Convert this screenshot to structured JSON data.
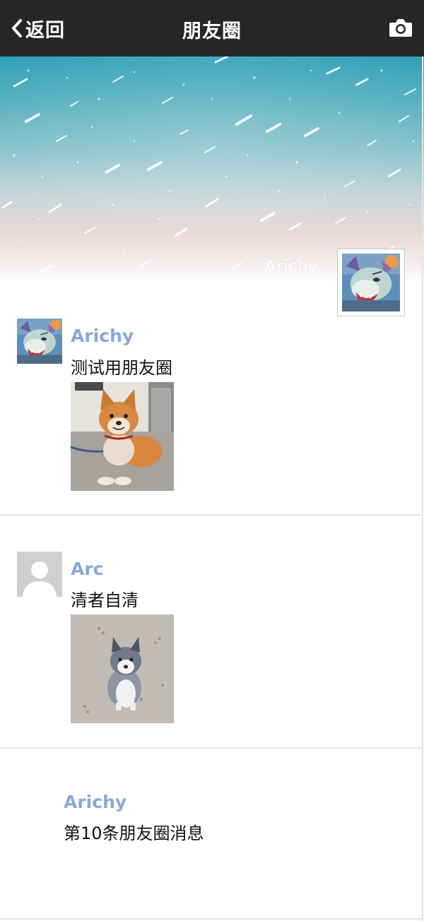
{
  "header": {
    "back_label": "返回",
    "title": "朋友圈",
    "back_icon": "chevron-left-icon",
    "camera_icon": "camera-icon"
  },
  "cover": {
    "username": "Arichy"
  },
  "posts": [
    {
      "name": "Arichy",
      "text": "测试用朋友圈",
      "avatar": "wolf-character-avatar",
      "image": "shiba-inu-dog-photo"
    },
    {
      "name": "Arc",
      "text": "清者自清",
      "avatar": "default-user-avatar",
      "image": "husky-puppy-photo"
    },
    {
      "name": "Arichy",
      "text": "第10条朋友圈消息"
    }
  ],
  "colors": {
    "navbar": "#262626",
    "name_link": "#8aa8d8",
    "divider": "#e3e3e3"
  }
}
